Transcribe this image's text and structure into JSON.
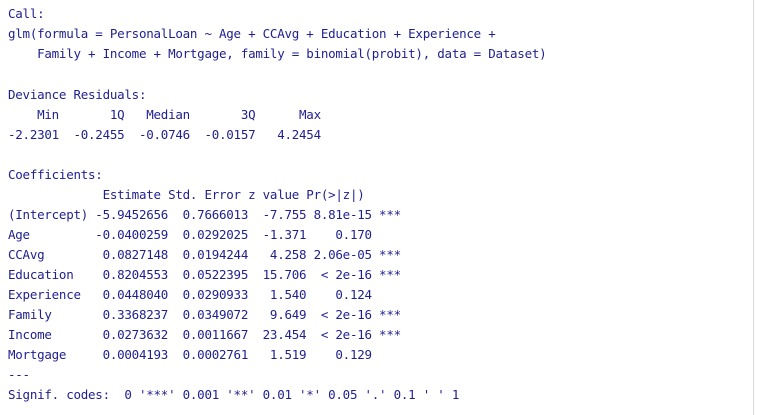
{
  "console": {
    "colors": {
      "text": "#1f1f8f",
      "background": "#ffffff"
    },
    "call": {
      "header": "Call:",
      "line1": "glm(formula = PersonalLoan ~ Age + CCAvg + Education + Experience +",
      "line2": "    Family + Income + Mortgage, family = binomial(probit), data = Dataset)"
    },
    "deviance": {
      "header": "Deviance Residuals:",
      "labels": "    Min       1Q   Median       3Q      Max  ",
      "values": "-2.2301  -0.2455  -0.0746  -0.0157   4.2454  "
    },
    "coefficients": {
      "header": "Coefficients:",
      "columns": "             Estimate Std. Error z value Pr(>|z|)    ",
      "rows": [
        "(Intercept) -5.9452656  0.7666013  -7.755 8.81e-15 ***",
        "Age         -0.0400259  0.0292025  -1.371    0.170    ",
        "CCAvg        0.0827148  0.0194244   4.258 2.06e-05 ***",
        "Education    0.8204553  0.0522395  15.706  < 2e-16 ***",
        "Experience   0.0448040  0.0290933   1.540    0.124    ",
        "Family       0.3368237  0.0349072   9.649  < 2e-16 ***",
        "Income       0.0273632  0.0011667  23.454  < 2e-16 ***",
        "Mortgage     0.0004193  0.0002761   1.519    0.129    "
      ],
      "separator": "---",
      "signif": "Signif. codes:  0 '***' 0.001 '**' 0.01 '*' 0.05 '.' 0.1 ' ' 1"
    }
  }
}
